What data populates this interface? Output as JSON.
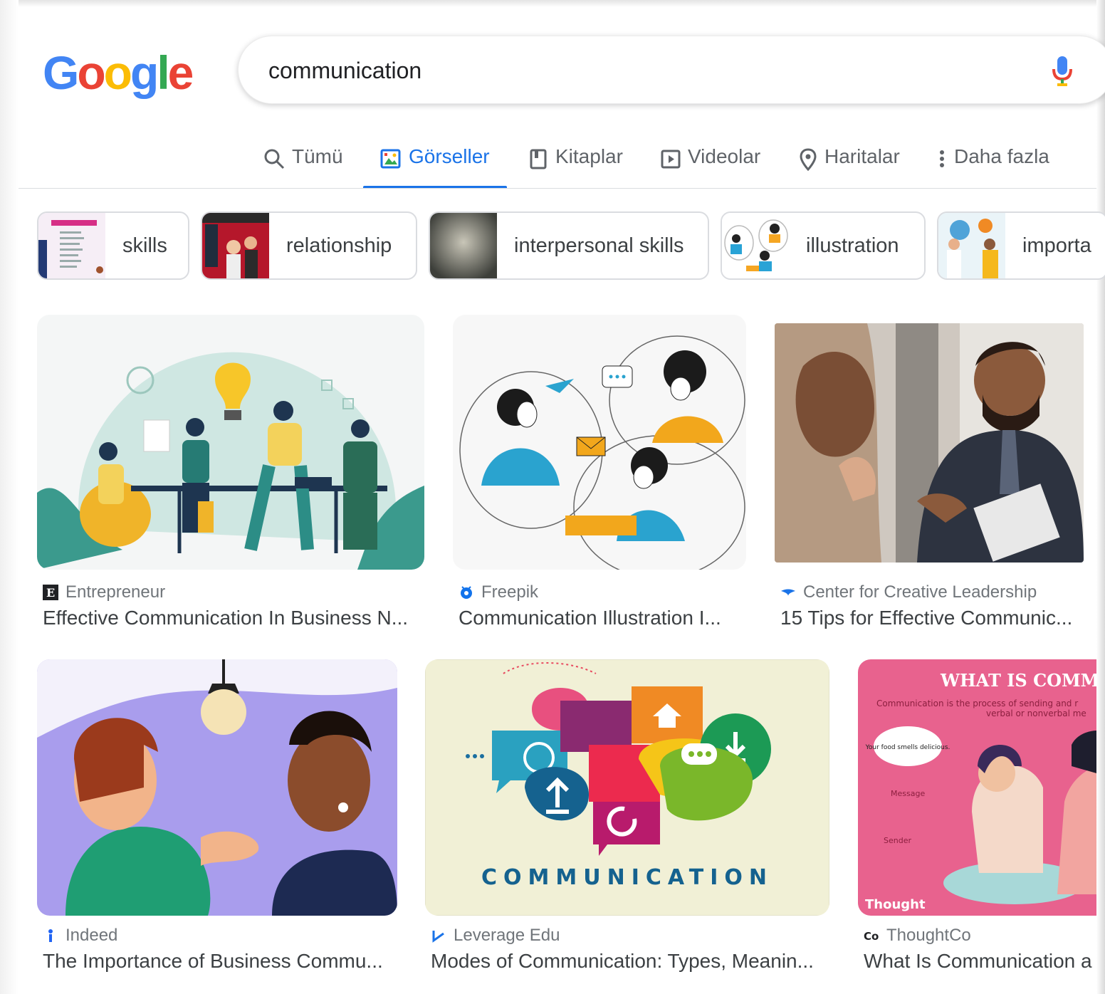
{
  "logo": {
    "g1": "G",
    "o1": "o",
    "o2": "o",
    "g2": "g",
    "l": "l",
    "e": "e"
  },
  "search": {
    "query": "communication"
  },
  "tabs": [
    {
      "label": "Tümü",
      "icon": "search-icon"
    },
    {
      "label": "Görseller",
      "icon": "image-icon",
      "active": true
    },
    {
      "label": "Kitaplar",
      "icon": "book-icon"
    },
    {
      "label": "Videolar",
      "icon": "play-icon"
    },
    {
      "label": "Haritalar",
      "icon": "map-pin-icon"
    },
    {
      "label": "Daha fazla",
      "icon": "more-vert-icon"
    }
  ],
  "chips": [
    {
      "label": "skills"
    },
    {
      "label": "relationship"
    },
    {
      "label": "interpersonal skills"
    },
    {
      "label": "illustration"
    },
    {
      "label": "importa"
    }
  ],
  "results": [
    {
      "source": "Entrepreneur",
      "title": "Effective Communication In Business N..."
    },
    {
      "source": "Freepik",
      "title": "Communication Illustration I..."
    },
    {
      "source": "Center for Creative Leadership",
      "title": "15 Tips for Effective Communic..."
    },
    {
      "source": "Indeed",
      "title": "The Importance of Business Commu..."
    },
    {
      "source": "Leverage Edu",
      "title": "Modes of Communication: Types, Meanin...",
      "image_text": "COMMUNICATION"
    },
    {
      "source": "ThoughtCo",
      "title": "What Is Communication a",
      "image_text": "WHAT IS COMMUN",
      "image_sub": "Communication is the process of sending and r",
      "image_sub2": "verbal or nonverbal me",
      "bubble": "Your food smells delicious.",
      "msg": "Message",
      "sender": "Sender",
      "brand": "Thought"
    }
  ],
  "colors": {
    "accent": "#1a73e8",
    "text": "#202124",
    "muted": "#70757a"
  }
}
